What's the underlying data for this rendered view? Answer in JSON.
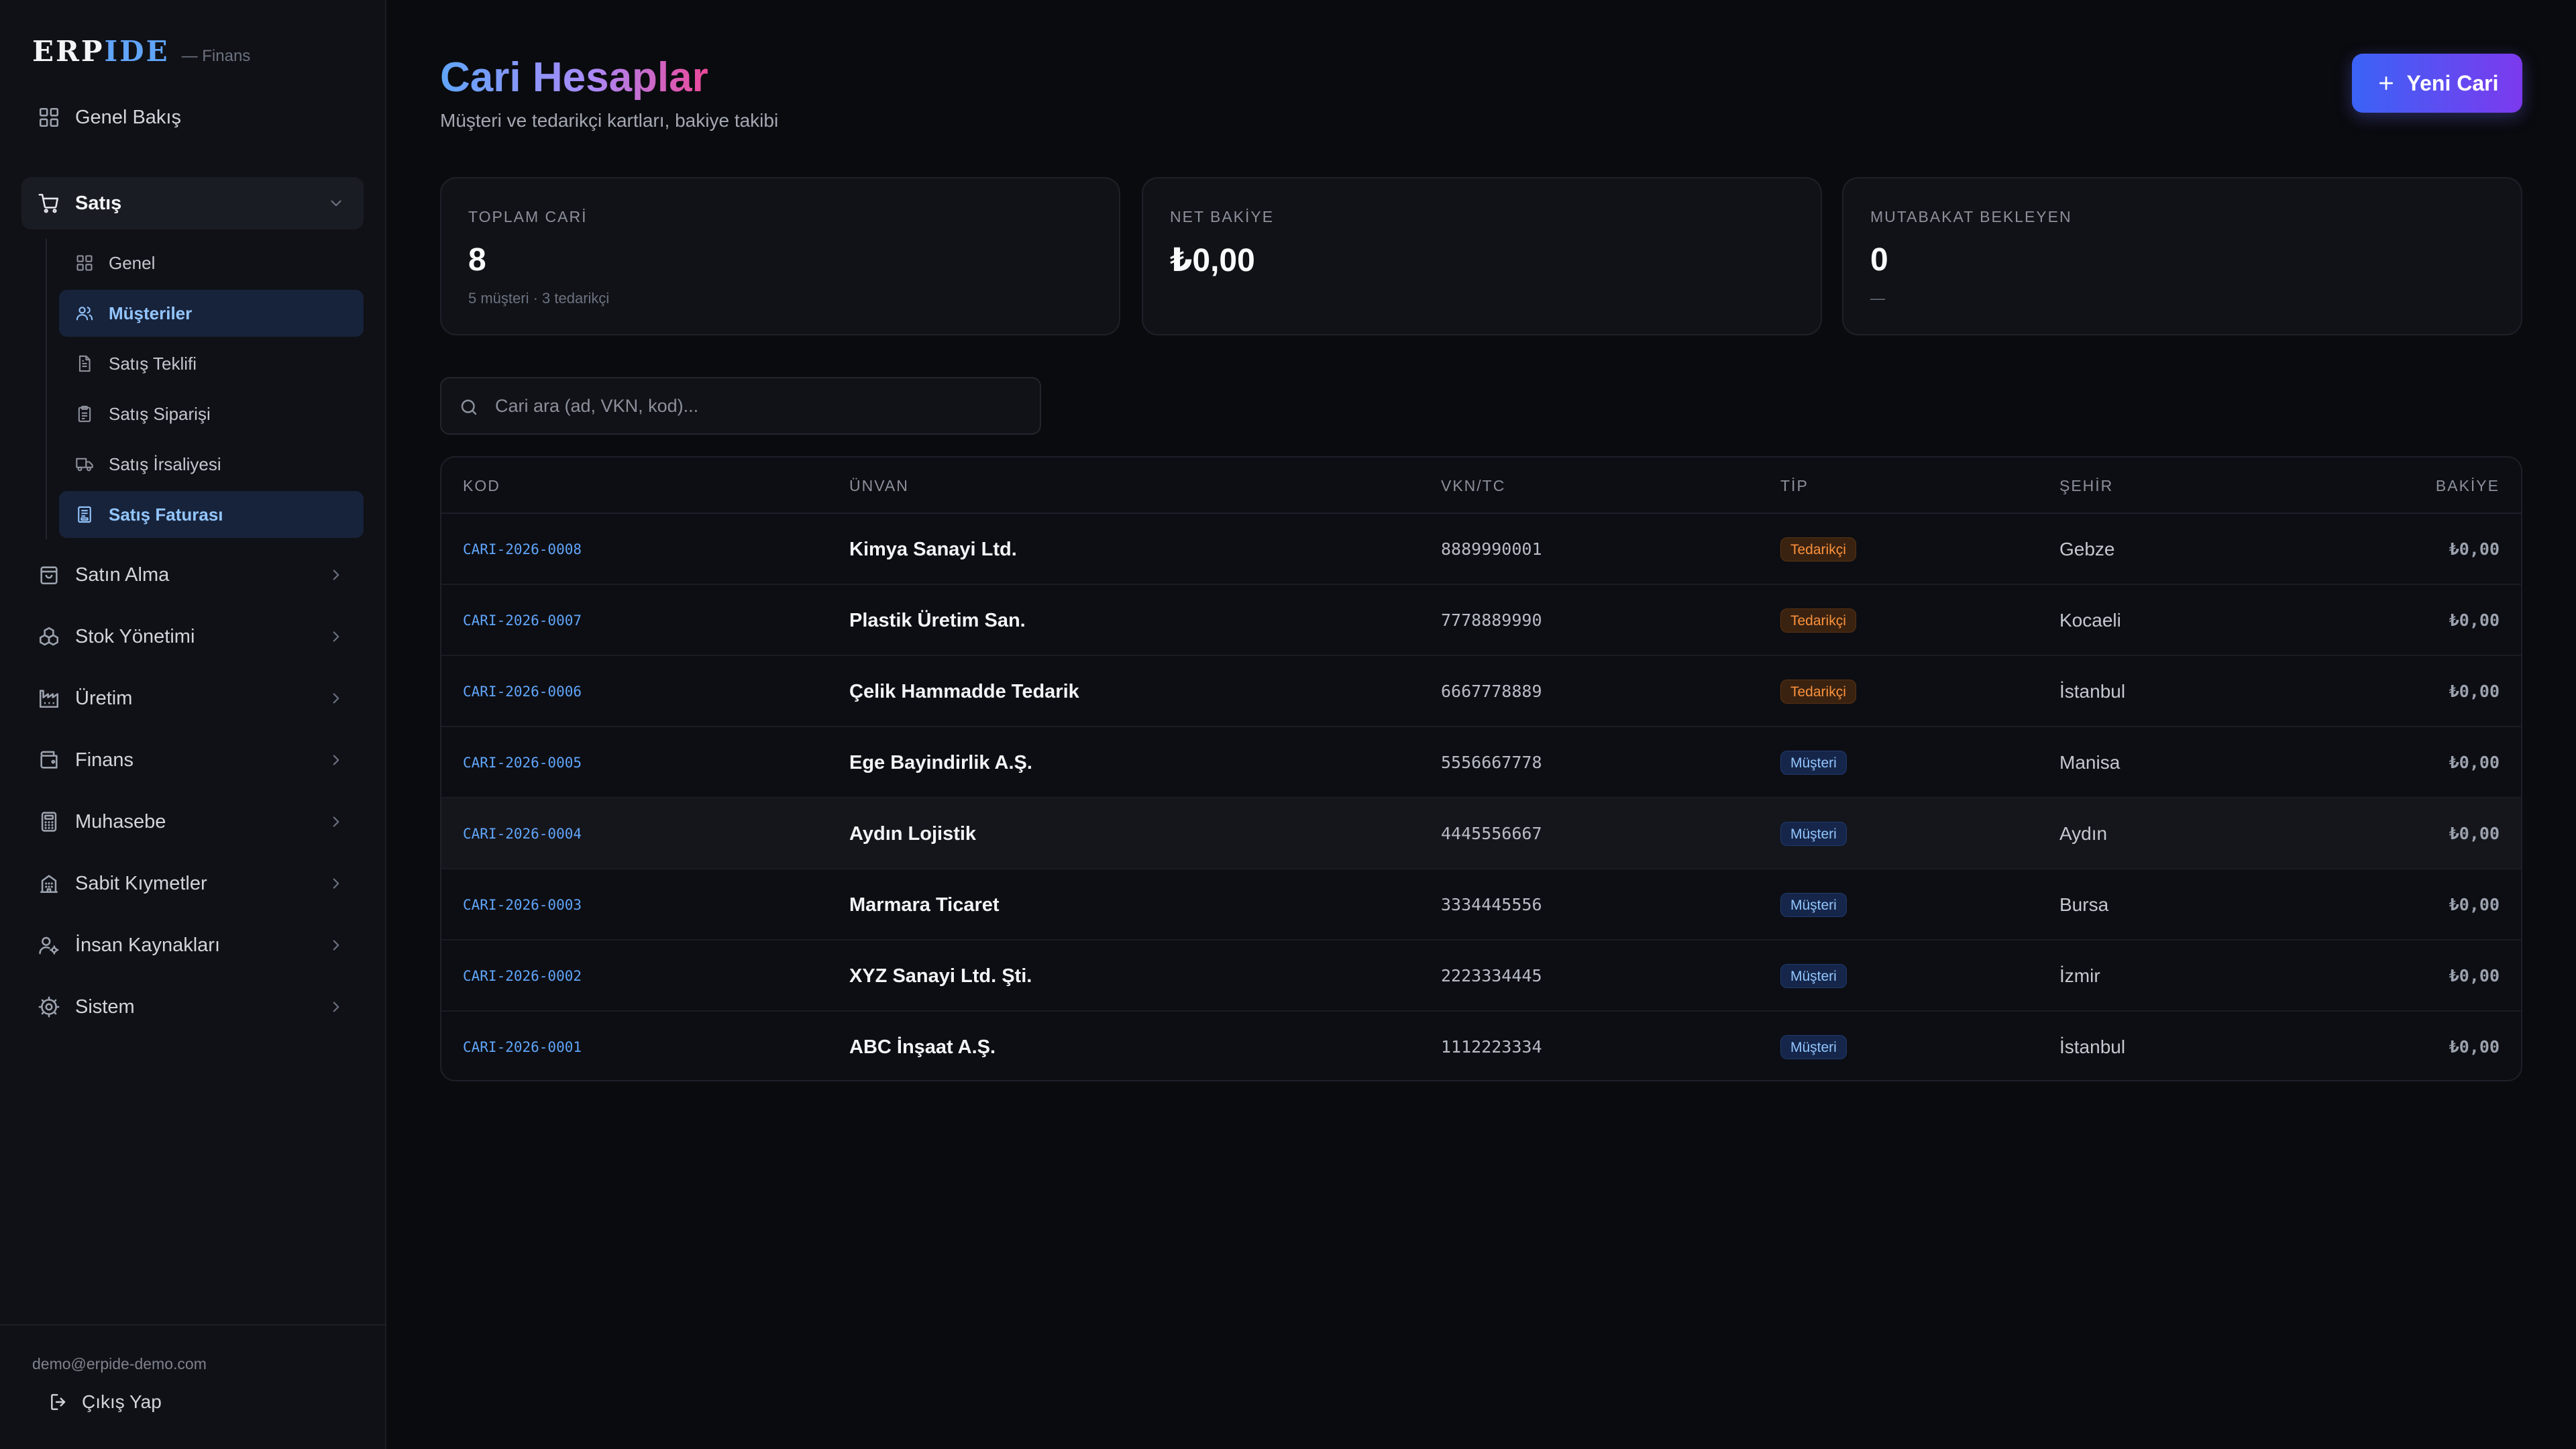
{
  "brand": {
    "name_a": "ERP",
    "name_b": "IDE",
    "subtitle": "— Finans"
  },
  "sidebar": {
    "overview": {
      "label": "Genel Bakış",
      "icon": "grid-icon"
    },
    "sales": {
      "label": "Satış",
      "icon": "cart-icon",
      "expanded": true,
      "items": [
        {
          "label": "Genel",
          "icon": "grid-icon"
        },
        {
          "label": "Müşteriler",
          "icon": "users-icon",
          "active": true
        },
        {
          "label": "Satış Teklifi",
          "icon": "document-icon"
        },
        {
          "label": "Satış Siparişi",
          "icon": "clipboard-icon"
        },
        {
          "label": "Satış İrsaliyesi",
          "icon": "truck-icon"
        },
        {
          "label": "Satış Faturası",
          "icon": "receipt-icon",
          "active": true
        }
      ]
    },
    "groups": [
      {
        "label": "Satın Alma",
        "icon": "shopping-bag-icon"
      },
      {
        "label": "Stok Yönetimi",
        "icon": "boxes-icon"
      },
      {
        "label": "Üretim",
        "icon": "factory-icon"
      },
      {
        "label": "Finans",
        "icon": "wallet-icon"
      },
      {
        "label": "Muhasebe",
        "icon": "calculator-icon"
      },
      {
        "label": "Sabit Kıymetler",
        "icon": "building-icon"
      },
      {
        "label": "İnsan Kaynakları",
        "icon": "user-cog-icon"
      },
      {
        "label": "Sistem",
        "icon": "settings-icon"
      }
    ]
  },
  "footer": {
    "email": "demo@erpide-demo.com",
    "logout_label": "Çıkış Yap"
  },
  "header": {
    "title": "Cari Hesaplar",
    "subtitle": "Müşteri ve tedarikçi kartları, bakiye takibi",
    "new_button": "Yeni Cari"
  },
  "stats": [
    {
      "label": "TOPLAM CARİ",
      "value": "8",
      "note": "5 müşteri · 3 tedarikçi"
    },
    {
      "label": "NET BAKİYE",
      "value": "₺0,00",
      "note": ""
    },
    {
      "label": "MUTABAKAT BEKLEYEN",
      "value": "0",
      "note": "—"
    }
  ],
  "search": {
    "placeholder": "Cari ara (ad, VKN, kod)..."
  },
  "table": {
    "columns": {
      "kod": "KOD",
      "unvan": "ÜNVAN",
      "vkn": "VKN/TC",
      "tip": "TİP",
      "sehir": "ŞEHİR",
      "bakiye": "BAKİYE"
    },
    "rows": [
      {
        "kod": "CARI-2026-0008",
        "unvan": "Kimya Sanayi Ltd.",
        "vkn": "8889990001",
        "tip": "Tedarikçi",
        "sehir": "Gebze",
        "bakiye": "₺0,00"
      },
      {
        "kod": "CARI-2026-0007",
        "unvan": "Plastik Üretim San.",
        "vkn": "7778889990",
        "tip": "Tedarikçi",
        "sehir": "Kocaeli",
        "bakiye": "₺0,00"
      },
      {
        "kod": "CARI-2026-0006",
        "unvan": "Çelik Hammadde Tedarik",
        "vkn": "6667778889",
        "tip": "Tedarikçi",
        "sehir": "İstanbul",
        "bakiye": "₺0,00"
      },
      {
        "kod": "CARI-2026-0005",
        "unvan": "Ege Bayindirlik A.Ş.",
        "vkn": "5556667778",
        "tip": "Müşteri",
        "sehir": "Manisa",
        "bakiye": "₺0,00"
      },
      {
        "kod": "CARI-2026-0004",
        "unvan": "Aydın Lojistik",
        "vkn": "4445556667",
        "tip": "Müşteri",
        "sehir": "Aydın",
        "bakiye": "₺0,00"
      },
      {
        "kod": "CARI-2026-0003",
        "unvan": "Marmara Ticaret",
        "vkn": "3334445556",
        "tip": "Müşteri",
        "sehir": "Bursa",
        "bakiye": "₺0,00"
      },
      {
        "kod": "CARI-2026-0002",
        "unvan": "XYZ Sanayi Ltd. Şti.",
        "vkn": "2223334445",
        "tip": "Müşteri",
        "sehir": "İzmir",
        "bakiye": "₺0,00"
      },
      {
        "kod": "CARI-2026-0001",
        "unvan": "ABC İnşaat A.Ş.",
        "vkn": "1112223334",
        "tip": "Müşteri",
        "sehir": "İstanbul",
        "bakiye": "₺0,00"
      }
    ]
  },
  "colors": {
    "background": "#0a0b0f",
    "sidebar": "#101116",
    "accent_blue": "#60a5fa",
    "title_gradient": [
      "#60a5fa",
      "#a78bfa",
      "#ec4899"
    ],
    "button_gradient": [
      "#3b63f6",
      "#7c3aed"
    ],
    "badge_supplier": "#fb923c",
    "badge_customer": "#93c5fd"
  }
}
